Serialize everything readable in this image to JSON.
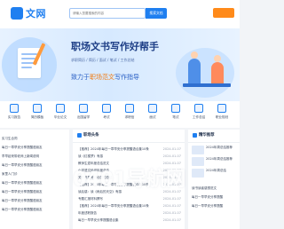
{
  "header": {
    "logo_text": "文网",
    "search_placeholder": "请输入您要搜索的内容",
    "search_button": "搜索文档"
  },
  "banner": {
    "title": "职场文书写作好帮手",
    "subtitle": "求职简历 / 简历 / 面试 / 笔试 / 工作总结",
    "slogan_prefix": "致力于",
    "slogan_highlight": "职场范文",
    "slogan_suffix": "写作指导"
  },
  "nav": {
    "items": [
      {
        "label": "实习报告",
        "icon": "document-icon"
      },
      {
        "label": "简历模板",
        "icon": "resume-icon"
      },
      {
        "label": "毕业论文",
        "icon": "graduation-icon"
      },
      {
        "label": "出国留学",
        "icon": "plane-icon"
      },
      {
        "label": "考试",
        "icon": "exam-icon"
      },
      {
        "label": "求职信",
        "icon": "letter-icon"
      },
      {
        "label": "面试",
        "icon": "interview-icon"
      },
      {
        "label": "笔试",
        "icon": "pen-icon"
      },
      {
        "label": "工作总结",
        "icon": "summary-icon"
      },
      {
        "label": "职业规划",
        "icon": "plan-icon"
      }
    ]
  },
  "left": {
    "items": [
      "实习生合同",
      "每日一章早安分享提醒语朋友",
      "早早起来带老师上新闻说明",
      "每日一章早安分享提醒语朋友",
      "家里人门诊",
      "每日一章早安分享提醒语朋友",
      "每日一章早安分享提醒语朋友",
      "每日一章早安分享提醒语朋友",
      "每日一章早安分享提醒语朋友"
    ]
  },
  "mid": {
    "title": "职场头条",
    "items": [
      {
        "text": "【推荐】2024年每日一章早安分享提醒语合集10条",
        "date": "2024-01-07"
      },
      {
        "text": "读《红楼梦》有感",
        "date": "2024-01-07"
      },
      {
        "text": "教师生涯年度总结范文",
        "date": "2024-01-07"
      },
      {
        "text": "小学语文科组年度总结",
        "date": "2024-01-07"
      },
      {
        "text": "关于开展考试动员的总结",
        "date": "2024-01-07"
      },
      {
        "text": "【推荐】2024年每日一章早安分享提醒语合集10条",
        "date": "2024-01-07"
      },
      {
        "text": "读后感：读《雨后的天空》有感",
        "date": "2024-01-07"
      },
      {
        "text": "专题汇报材料撰写",
        "date": "2024-01-07"
      },
      {
        "text": "【推荐】2024年每日一章早安分享提醒语合集10条",
        "date": "2024-01-07"
      },
      {
        "text": "年度述职报告",
        "date": "2024-01-07"
      },
      {
        "text": "每日一早早安分享提醒语合集",
        "date": "2024-01-07"
      }
    ]
  },
  "right": {
    "title": "精华推荐",
    "cards": [
      {
        "text": "2024年周总结推荐"
      },
      {
        "text": "2024年周总结推荐"
      },
      {
        "text": "2024年周总结"
      }
    ],
    "items": [
      "读书读者感想范文",
      "每日一早早安分享提醒",
      "每日一早早安分享提醒"
    ]
  },
  "watermark": "0401导航网"
}
